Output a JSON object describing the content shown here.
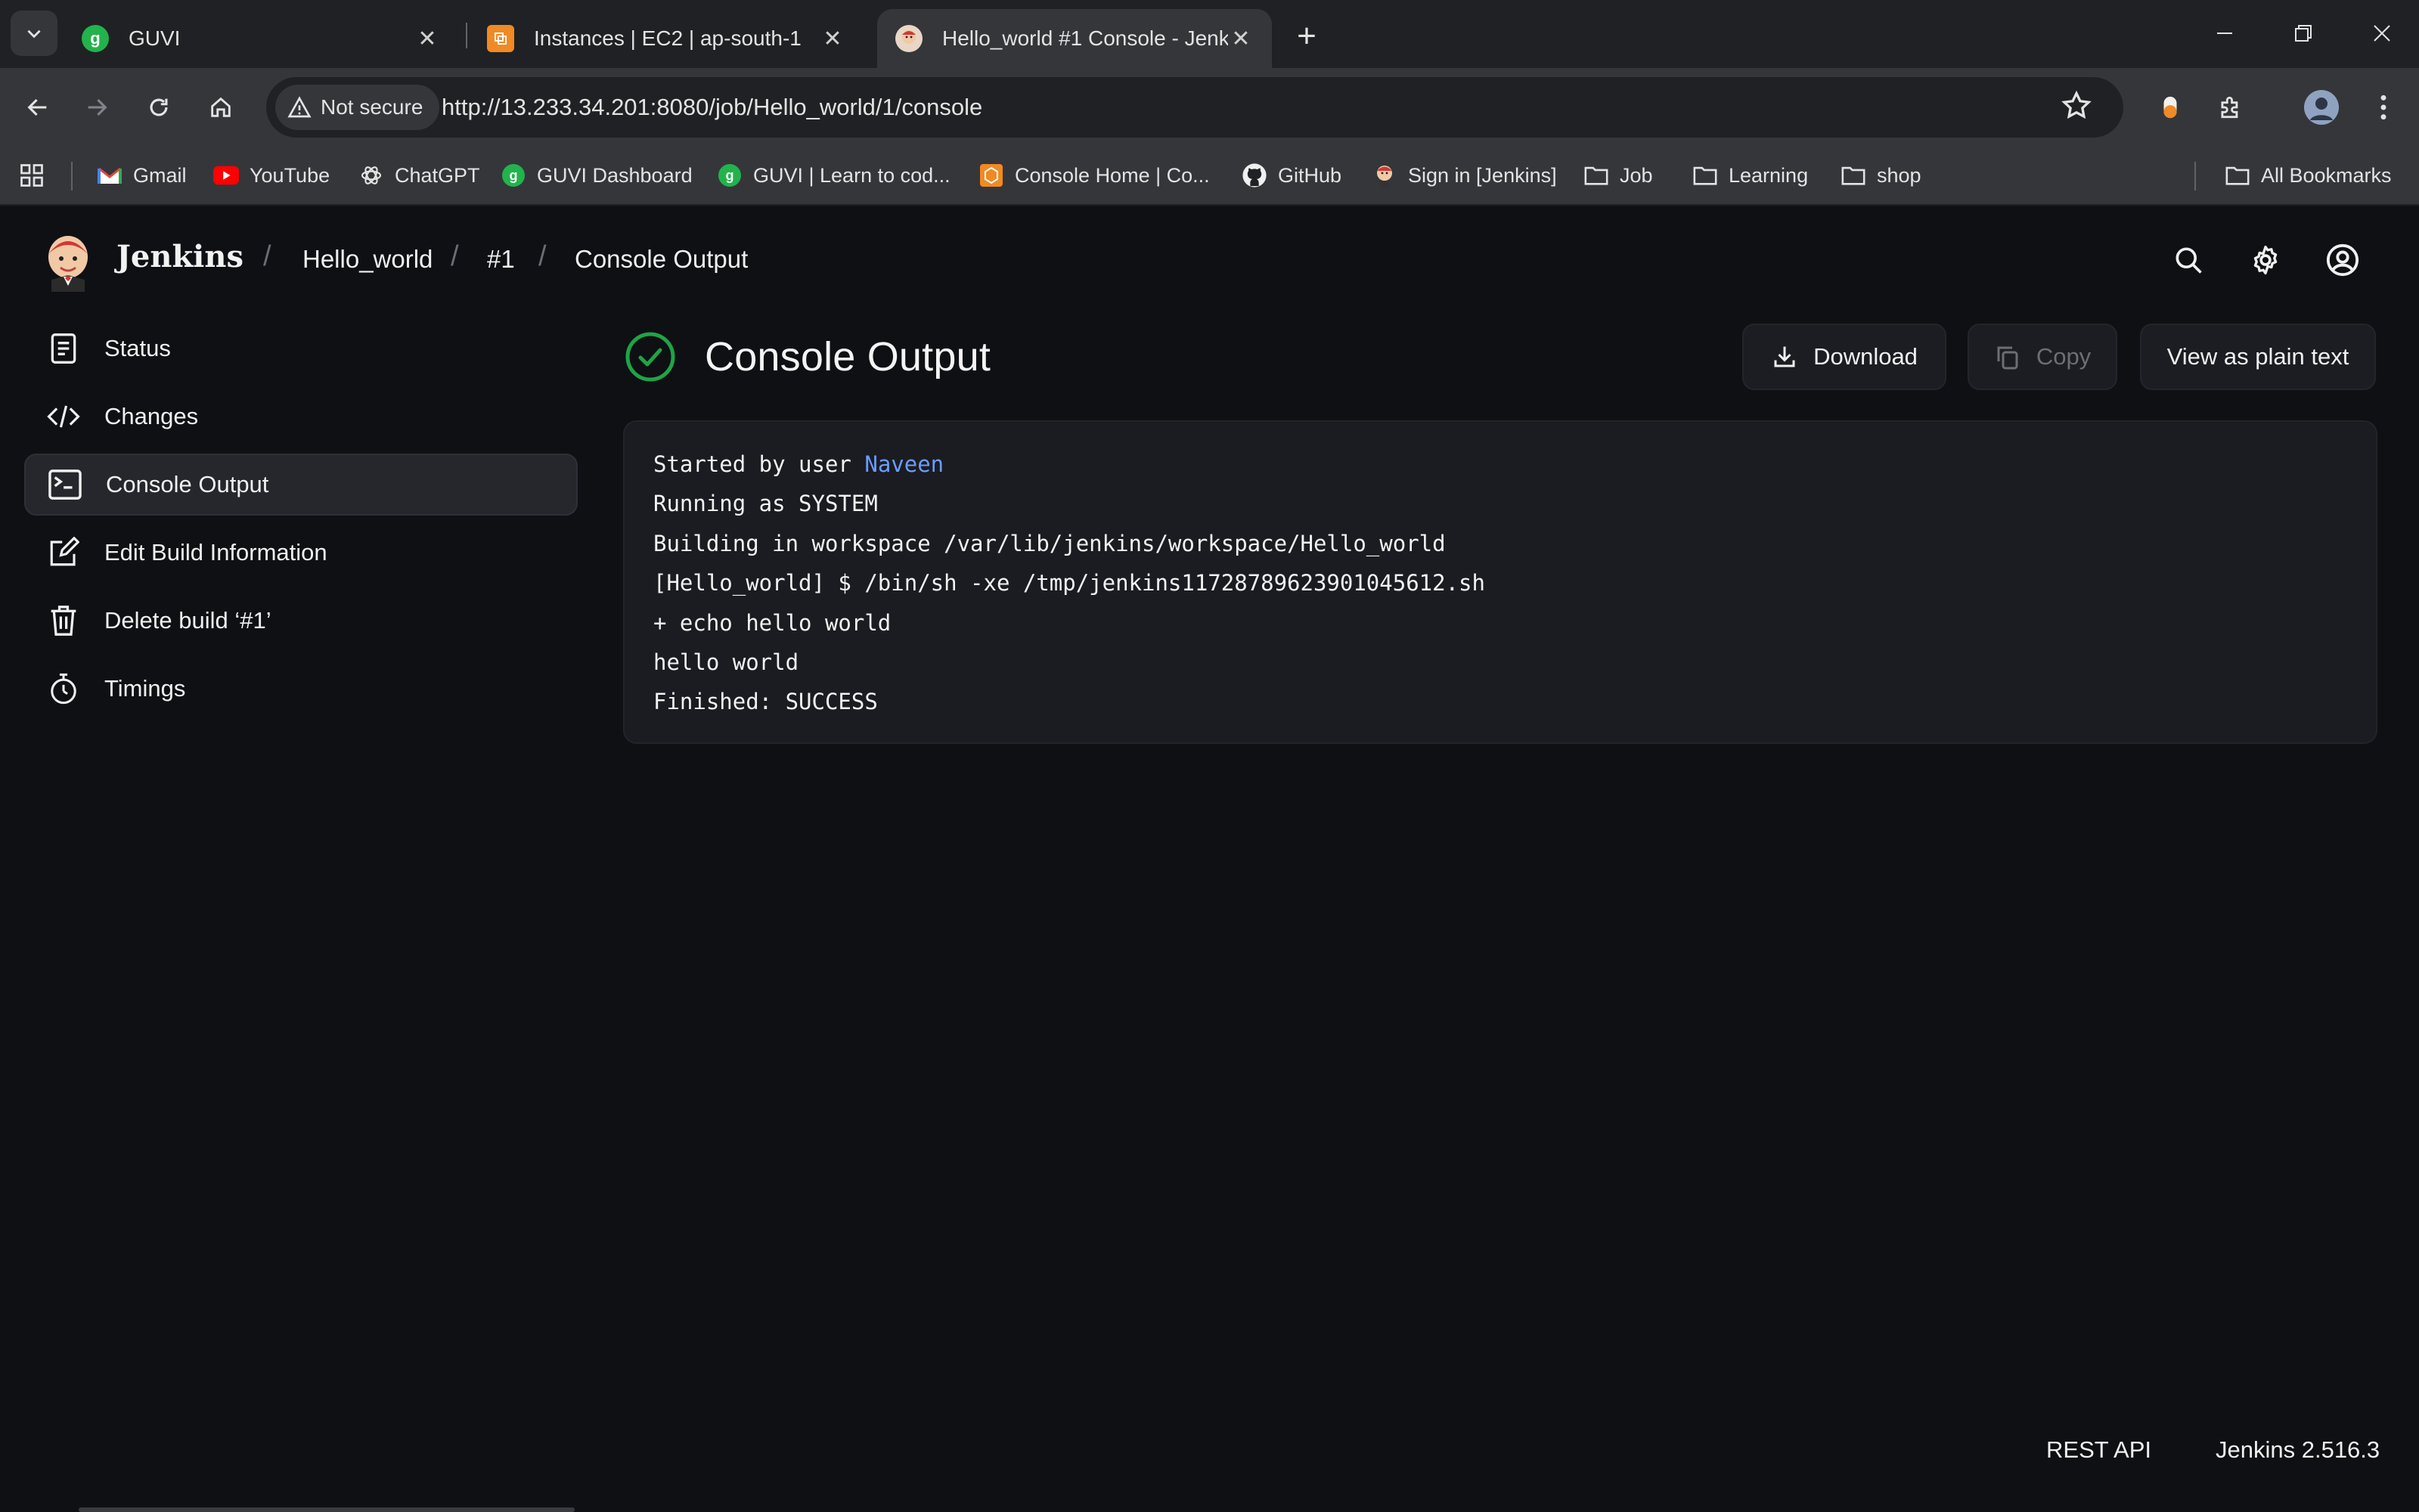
{
  "browser": {
    "tabs": [
      {
        "title": "GUVI",
        "favicon": "guvi-icon",
        "color": "#22b34c"
      },
      {
        "title": "Instances | EC2 | ap-south-1",
        "favicon": "aws-ec2-icon",
        "color": "#f08a24"
      },
      {
        "title": "Hello_world #1 Console - Jenkins",
        "favicon": "jenkins-icon",
        "active": true
      }
    ],
    "security_label": "Not secure",
    "url": "http://13.233.34.201:8080/job/Hello_world/1/console",
    "bookmarks": [
      {
        "label": "Gmail",
        "icon": "gmail-icon"
      },
      {
        "label": "YouTube",
        "icon": "youtube-icon"
      },
      {
        "label": "ChatGPT",
        "icon": "chatgpt-icon"
      },
      {
        "label": "GUVI Dashboard",
        "icon": "guvi-icon"
      },
      {
        "label": "GUVI | Learn to cod...",
        "icon": "guvi-icon"
      },
      {
        "label": "Console Home | Co...",
        "icon": "aws-console-icon"
      },
      {
        "label": "GitHub",
        "icon": "github-icon"
      },
      {
        "label": "Sign in [Jenkins]",
        "icon": "jenkins-icon"
      },
      {
        "label": "Job",
        "icon": "folder-icon"
      },
      {
        "label": "Learning",
        "icon": "folder-icon"
      },
      {
        "label": "shop",
        "icon": "folder-icon"
      }
    ],
    "all_bookmarks": "All Bookmarks"
  },
  "jenkins": {
    "brand": "Jenkins",
    "breadcrumbs": [
      "Hello_world",
      "#1",
      "Console Output"
    ],
    "sidebar": [
      {
        "label": "Status",
        "icon": "document-icon"
      },
      {
        "label": "Changes",
        "icon": "code-icon"
      },
      {
        "label": "Console Output",
        "icon": "terminal-icon",
        "active": true
      },
      {
        "label": "Edit Build Information",
        "icon": "edit-icon"
      },
      {
        "label": "Delete build ‘#1’",
        "icon": "trash-icon"
      },
      {
        "label": "Timings",
        "icon": "stopwatch-icon"
      }
    ],
    "page_title": "Console Output",
    "status": "success",
    "status_color": "#1ea446",
    "actions": {
      "download": "Download",
      "copy": "Copy",
      "plain_text": "View as plain text"
    },
    "console": {
      "started_prefix": "Started by user ",
      "started_user": "Naveen",
      "lines": [
        "Running as SYSTEM",
        "Building in workspace /var/lib/jenkins/workspace/Hello_world",
        "[Hello_world] $ /bin/sh -xe /tmp/jenkins11728789623901045612.sh",
        "+ echo hello world",
        "hello world",
        "Finished: SUCCESS"
      ]
    },
    "footer": {
      "rest_api": "REST API",
      "version": "Jenkins 2.516.3"
    }
  }
}
